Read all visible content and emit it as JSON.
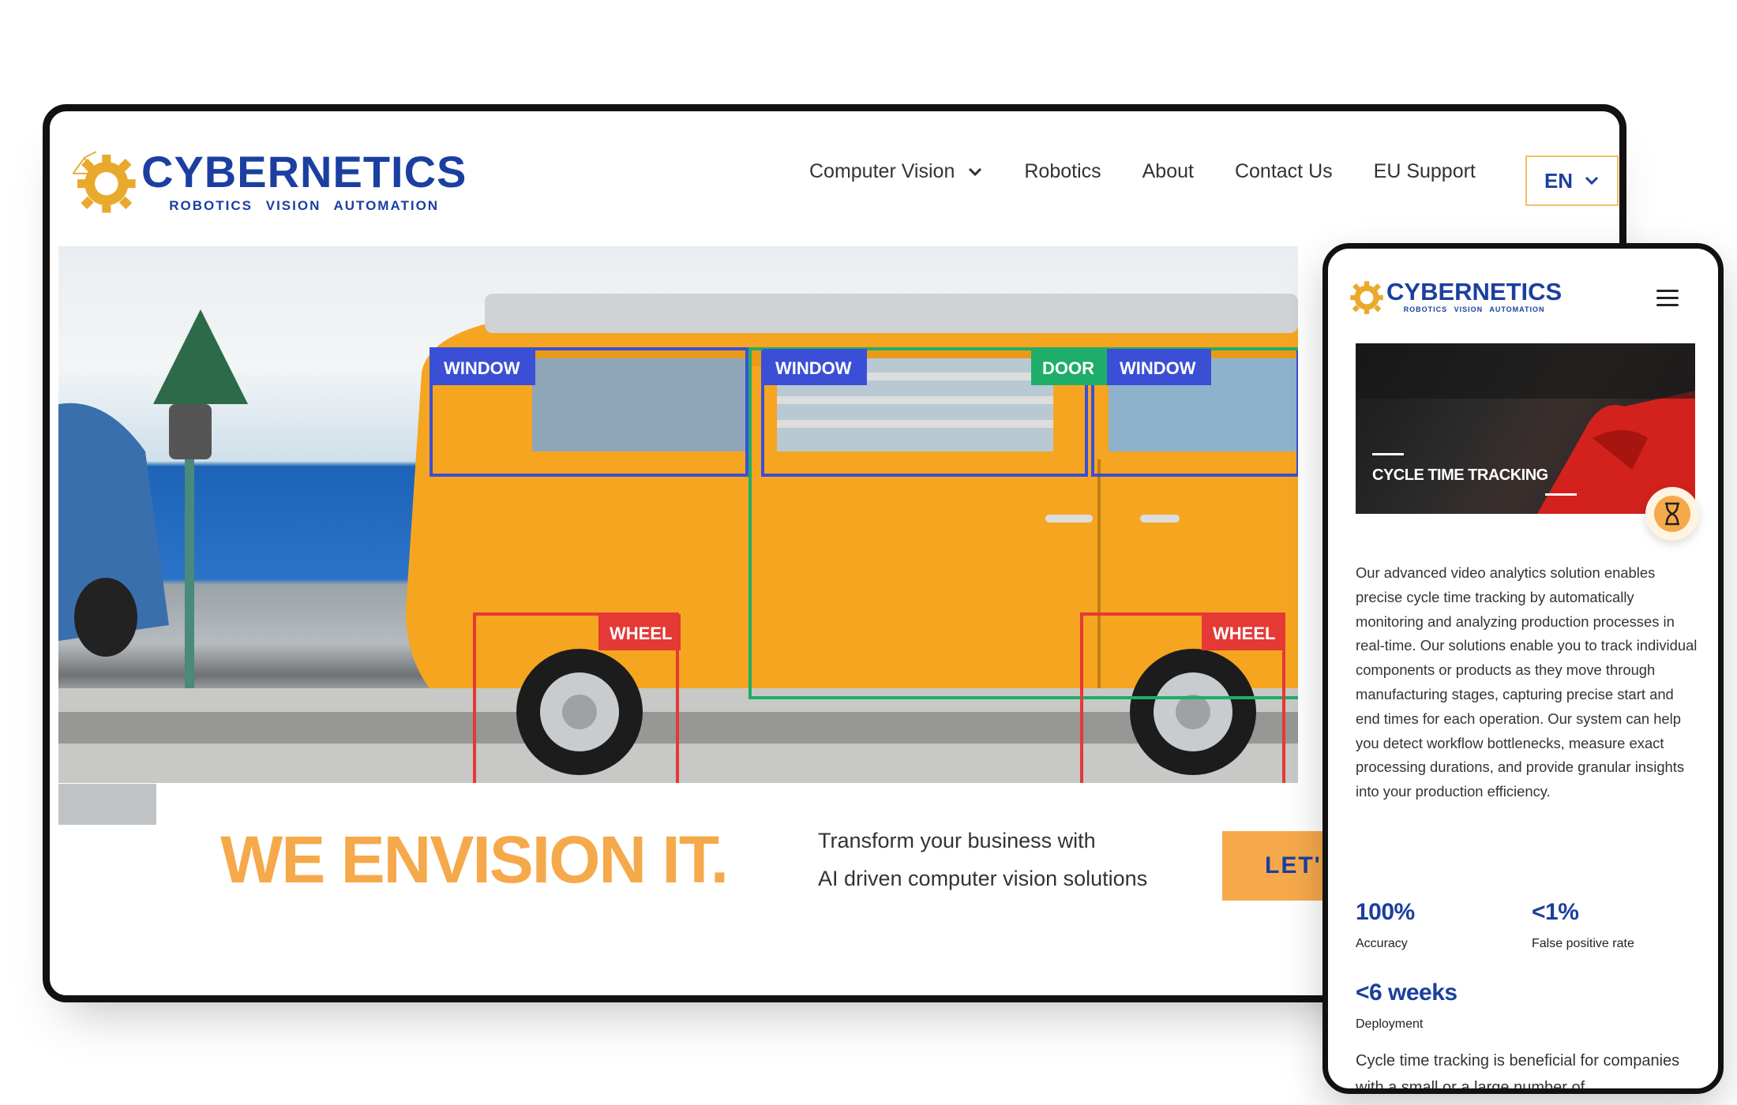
{
  "brand": {
    "name": "CYBERNETICS",
    "tagline": "ROBOTICS   VISION   AUTOMATION",
    "colors": {
      "primary_blue": "#1b3fa0",
      "accent_orange": "#f6a94a",
      "gear_gold": "#e8a92c"
    }
  },
  "desktop": {
    "nav": [
      {
        "label": "Computer Vision",
        "has_dropdown": true
      },
      {
        "label": "Robotics"
      },
      {
        "label": "About"
      },
      {
        "label": "Contact Us"
      },
      {
        "label": "EU Support"
      }
    ],
    "language": "EN",
    "detections": [
      {
        "label": "WINDOW",
        "color": "#3b4fd6"
      },
      {
        "label": "WINDOW",
        "color": "#3b4fd6"
      },
      {
        "label": "DOOR",
        "color": "#1fae6a"
      },
      {
        "label": "WINDOW",
        "color": "#3b4fd6"
      },
      {
        "label": "WHEEL",
        "color": "#e53935"
      },
      {
        "label": "WHEEL",
        "color": "#e53935"
      }
    ],
    "hero": {
      "headline": "WE ENVISION IT.",
      "sub_line1": "Transform your business with",
      "sub_line2": "AI driven computer vision solutions",
      "cta": "LET'S TALK"
    }
  },
  "mobile": {
    "card_title": "CYCLE TIME TRACKING",
    "card_icon": "hourglass-icon",
    "description": "Our advanced video analytics solution enables precise cycle time tracking by automatically monitoring and analyzing production processes in real-time. Our solutions enable you to track individual components or products as they move through manufacturing stages, capturing precise start and end times for each operation. Our system can help you detect workflow bottlenecks, measure exact processing durations, and provide granular insights into your production efficiency.",
    "stats": [
      {
        "value": "100%",
        "label": "Accuracy"
      },
      {
        "value": "<1%",
        "label": "False positive rate"
      },
      {
        "value": "<6 weeks",
        "label": "Deployment"
      }
    ],
    "footer_text": "Cycle time tracking is beneficial for companies with a small or a large number of"
  }
}
